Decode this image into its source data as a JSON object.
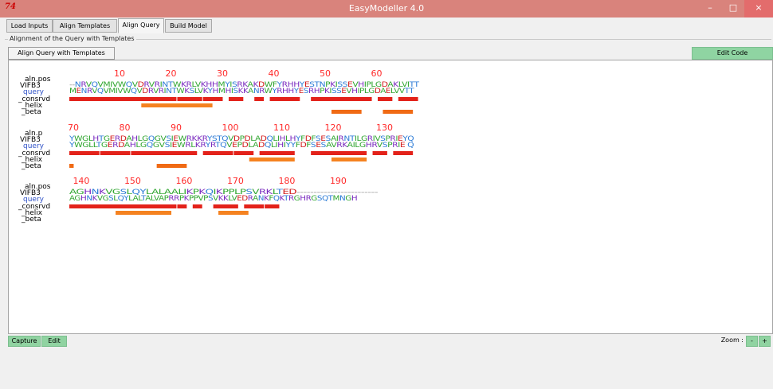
{
  "window": {
    "title": "EasyModeller 4.0",
    "app_icon_text": "74",
    "controls": {
      "minimize": "–",
      "maximize": "□",
      "close": "×"
    }
  },
  "tabs": [
    {
      "label": "Load Inputs",
      "active": false
    },
    {
      "label": "Align Templates",
      "active": false
    },
    {
      "label": "Align Query",
      "active": true
    },
    {
      "label": "Build Model",
      "active": false
    }
  ],
  "group": {
    "label": "Alignment of the Query with Templates"
  },
  "buttons": {
    "align": "Align Query with Templates",
    "edit_code": "Edit Code",
    "capture": "Capture",
    "edit": "Edit",
    "zoom_minus": "-",
    "zoom_plus": "+"
  },
  "zoom": {
    "label": "Zoom :"
  },
  "colors": {
    "titlebar": "#d9837c",
    "green_button": "#8fd4a2",
    "position_numbers": "#ff2a2a",
    "consrvd": "#e3221a",
    "helix": "#f58220",
    "beta": "#f06a14"
  },
  "alignment": {
    "blocks": [
      {
        "labels": [
          "aln.pos",
          "VIFB3",
          "query",
          "_consrvd",
          "_helix",
          "_beta"
        ],
        "numbers": [
          "10",
          "20",
          "30",
          "40",
          "50",
          "60"
        ],
        "template_seq": "--NRVQVMIVWQVDRVRINTWKRLVKHHMYISRKAKDWFYRHHYESTNPKISSEVHIPLGDAKLVITT",
        "query_seq": "MENRVQVMIVWQVDRVRINTWKSLVKYHMHISKKANRWYRHHYESRHPKISSEVHIPLGDAELVVTT"
      },
      {
        "labels": [
          "aln.p",
          "VIFB3",
          "query",
          "_consrvd",
          "_helix",
          "_beta"
        ],
        "numbers": [
          "70",
          "80",
          "90",
          "100",
          "110",
          "120",
          "130"
        ],
        "template_seq": "YWGLHTGERDAHLGQGVSIEWRKKRYSTQVDPDLADQLIHLHYFDFSESAIRNTILGRIVSPRIEYQ",
        "query_seq": "YWGLLTGERDAHLGQGVSIEWRLKRYRTQVEPDLADQLIHIYYFDFSESAVRKAILGHRVSPRIE Q"
      },
      {
        "labels": [
          "aln.pos",
          "VIFB3",
          "query",
          "_consrvd",
          "_helix",
          "_beta"
        ],
        "numbers": [
          "140",
          "150",
          "160",
          "170",
          "180",
          "190"
        ],
        "template_seq": "AGHNKVGSLQYLALAALIKPKQIKPPLPSVRKLTED------------------------",
        "query_seq": "AGHNKVGSLQYLALTALVAPRRPKPPVPSVKKLVEDRANKFQKTRGHRGSQTMNGH"
      }
    ]
  }
}
